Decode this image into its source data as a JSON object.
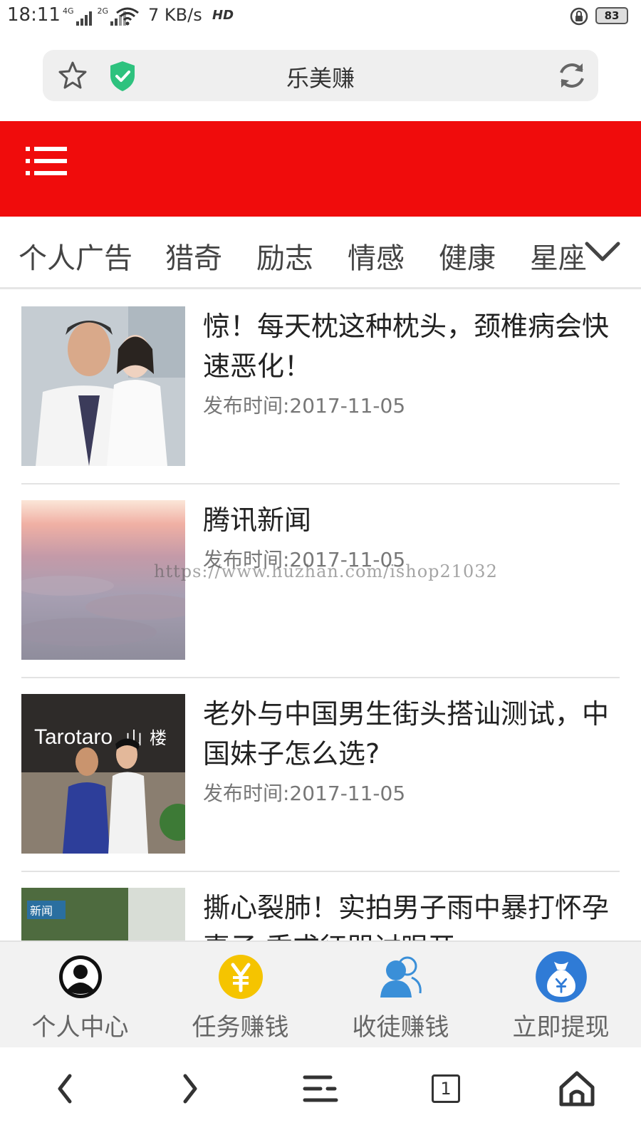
{
  "status_bar": {
    "time": "18:11",
    "net1": "4G",
    "net2": "2G",
    "speed": "7 KB/s",
    "hd": "HD",
    "battery": "83"
  },
  "address_bar": {
    "title": "乐美赚"
  },
  "header": {
    "color": "#f00c0c"
  },
  "categories": [
    "个人广告",
    "猎奇",
    "励志",
    "情感",
    "健康",
    "星座"
  ],
  "news": [
    {
      "title": "惊！每天枕这种枕头，颈椎病会快速恶化！",
      "time": "发布时间:2017-11-05"
    },
    {
      "title": "腾讯新闻",
      "time": "发布时间:2017-11-05"
    },
    {
      "title": "老外与中国男生街头搭讪测试，中国妹子怎么选?",
      "time": "发布时间:2017-11-05"
    },
    {
      "title": "撕心裂肺！实拍男子雨中暴打怀孕妻子 乘求征哭讨眼开"
    }
  ],
  "thumb_text": {
    "news3_sign": "Tarotaro",
    "news3_sign2": "山",
    "news3_sign3": "楼",
    "news4_tag": "新闻"
  },
  "watermark": "https://www.huzhan.com/ishop21032",
  "app_nav": [
    {
      "label": "个人中心",
      "icon": "user-circle-icon"
    },
    {
      "label": "任务赚钱",
      "icon": "yuan-coin-icon"
    },
    {
      "label": "收徒赚钱",
      "icon": "users-icon"
    },
    {
      "label": "立即提现",
      "icon": "money-bag-icon"
    }
  ],
  "browser_toolbar": {
    "tab_count": "1"
  }
}
